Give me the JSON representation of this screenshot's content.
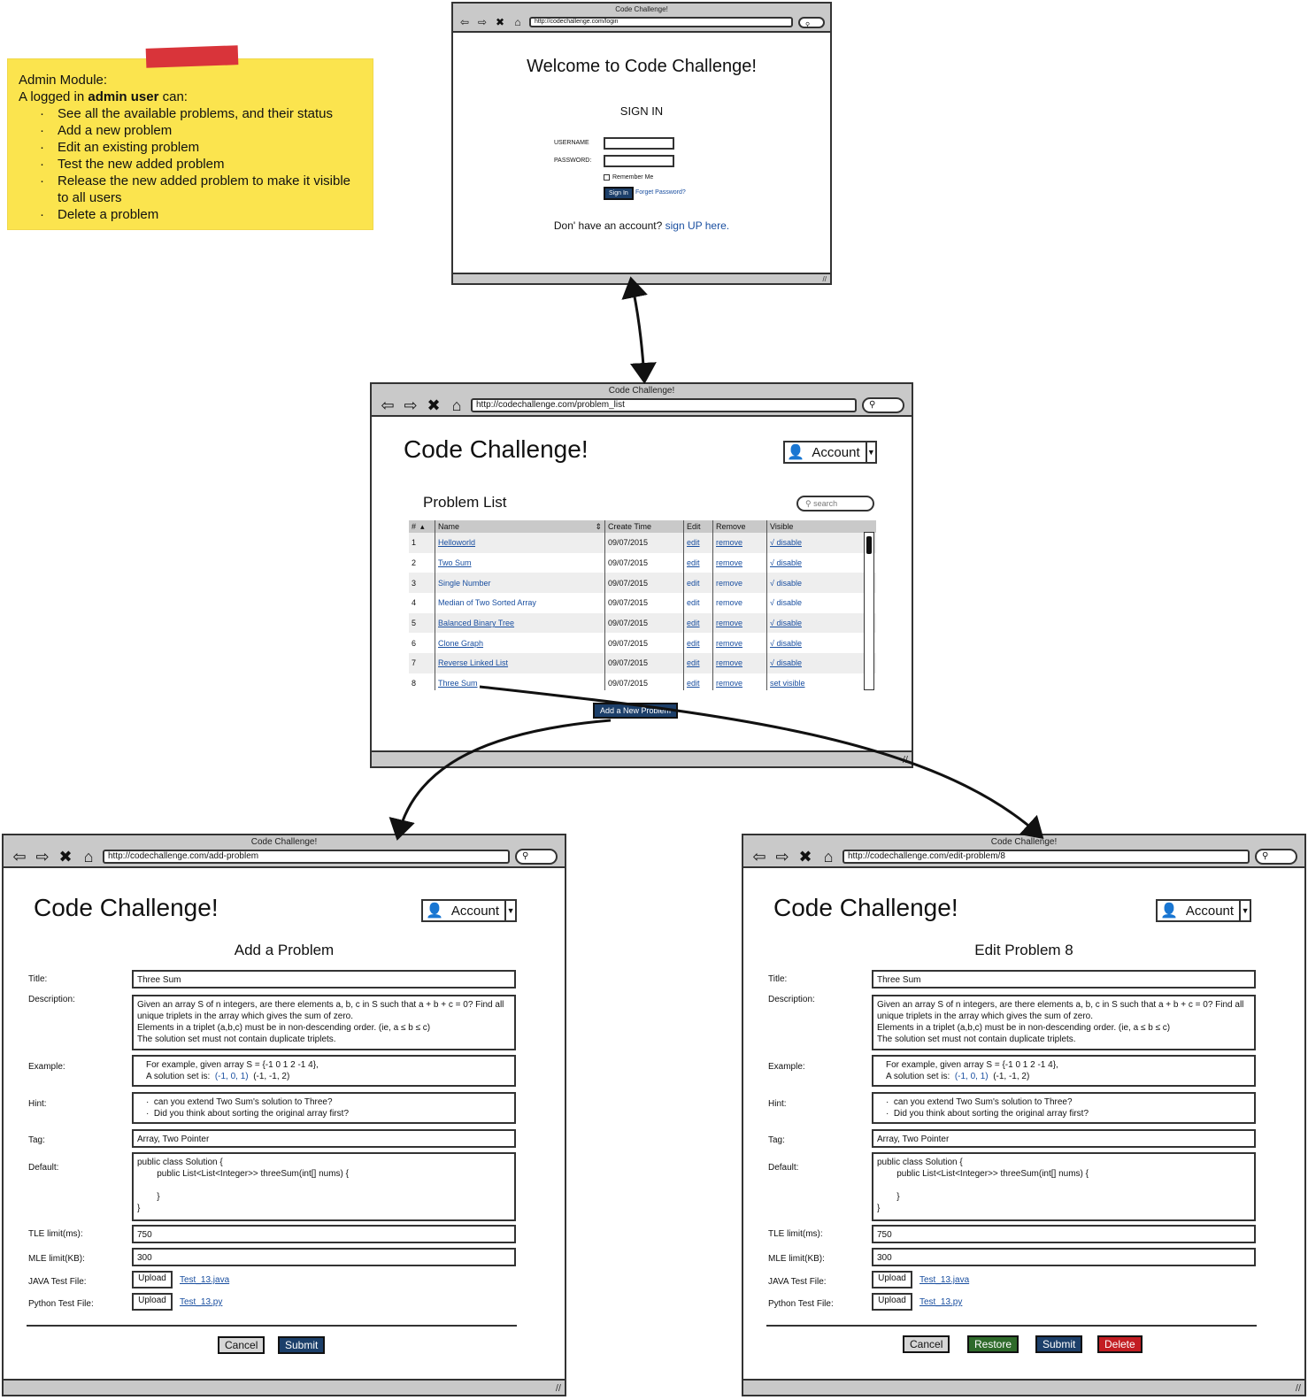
{
  "note": {
    "title": "Admin Module:",
    "intro_prefix": "A logged in ",
    "intro_bold": "admin user",
    "intro_suffix": " can:",
    "items": [
      "See all the available problems, and their status",
      "Add a new problem",
      "Edit an existing problem",
      "Test the new added problem",
      "Release the new added problem to make it visible to all users",
      "Delete a problem"
    ],
    "tape_color": "#d9343a",
    "bg_color": "#fbe44e"
  },
  "login": {
    "window_title": "Code Challenge!",
    "url": "http://codechallenge.com/login",
    "heading": "Welcome to Code Challenge!",
    "signin_label": "SIGN IN",
    "username_label": "USERNAME",
    "password_label": "PASSWORD:",
    "remember_label": "Remember Me",
    "signin_button": "Sign In",
    "forgot_link": "Forget Password?",
    "signup_text": "Don' have an account?",
    "signup_link": "sign UP here."
  },
  "list": {
    "window_title": "Code Challenge!",
    "url": "http://codechallenge.com/problem_list",
    "app_title": "Code Challenge!",
    "account_label": "Account",
    "page_title": "Problem List",
    "search_placeholder": "search",
    "columns": [
      "#",
      "Name",
      "Create Time",
      "Edit",
      "Remove",
      "Visible"
    ],
    "rows": [
      {
        "num": "1",
        "name": "Helloworld",
        "time": "09/07/2015",
        "edit": "edit",
        "remove": "remove",
        "visible": "√ disable"
      },
      {
        "num": "2",
        "name": "Two Sum",
        "time": "09/07/2015",
        "edit": "edit",
        "remove": "remove",
        "visible": "√ disable"
      },
      {
        "num": "3",
        "name": "Single Number",
        "time": "09/07/2015",
        "edit": "edit",
        "remove": "remove",
        "visible": "√ disable"
      },
      {
        "num": "4",
        "name": "Median of Two Sorted Array",
        "time": "09/07/2015",
        "edit": "edit",
        "remove": "remove",
        "visible": "√ disable"
      },
      {
        "num": "5",
        "name": "Balanced Binary Tree",
        "time": "09/07/2015",
        "edit": "edit",
        "remove": "remove",
        "visible": "√ disable"
      },
      {
        "num": "6",
        "name": "Clone Graph",
        "time": "09/07/2015",
        "edit": "edit",
        "remove": "remove",
        "visible": "√ disable"
      },
      {
        "num": "7",
        "name": "Reverse Linked List",
        "time": "09/07/2015",
        "edit": "edit",
        "remove": "remove",
        "visible": "√ disable"
      },
      {
        "num": "8",
        "name": "Three Sum",
        "time": "09/07/2015",
        "edit": "edit",
        "remove": "remove",
        "visible": "set visible"
      }
    ],
    "add_button": "Add a New Problem"
  },
  "add": {
    "window_title": "Code Challenge!",
    "url": "http://codechallenge.com/add-problem",
    "app_title": "Code Challenge!",
    "account_label": "Account",
    "page_title": "Add a Problem",
    "cancel_button": "Cancel",
    "submit_button": "Submit"
  },
  "edit": {
    "window_title": "Code Challenge!",
    "url": "http://codechallenge.com/edit-problem/8",
    "app_title": "Code Challenge!",
    "account_label": "Account",
    "page_title": "Edit Problem 8",
    "cancel_button": "Cancel",
    "restore_button": "Restore",
    "submit_button": "Submit",
    "delete_button": "Delete"
  },
  "form": {
    "labels": {
      "title": "Title:",
      "description": "Description:",
      "example": "Example:",
      "hint": "Hint:",
      "tag": "Tag:",
      "default": "Default:",
      "tle": "TLE limit(ms):",
      "mle": "MLE limit(KB):",
      "java": "JAVA Test File:",
      "python": "Python Test File:"
    },
    "values": {
      "title": "Three Sum",
      "description": "Given an array S of n integers, are there elements a, b, c in S such that a + b + c = 0? Find all\nunique triplets in the array which gives the sum of zero.\nElements in a triplet (a,b,c) must be in non-descending order. (ie, a ≤ b ≤ c)\nThe solution set must not contain duplicate triplets.",
      "example_line1": "For example, given array S = {-1 0 1 2 -1 4},",
      "example_line2_prefix": "A solution set is:",
      "example_set1": "(-1, 0, 1)",
      "example_set2": "(-1, -1, 2)",
      "hint": "·  can you extend Two Sum's solution to Three?\n·  Did you think about sorting the original array first?",
      "tag": "Array, Two Pointer",
      "default_code": "public class Solution {\n        public List<List<Integer>> threeSum(int[] nums) {\n\n        }\n}",
      "tle": "750",
      "mle": "300",
      "upload": "Upload",
      "java_file": "Test_13.java",
      "python_file": "Test_13.py"
    }
  },
  "icons": [
    "back-arrow-icon",
    "forward-arrow-icon",
    "close-icon",
    "home-icon",
    "search-icon",
    "person-icon",
    "chevron-down-icon",
    "resize-grip-icon"
  ]
}
